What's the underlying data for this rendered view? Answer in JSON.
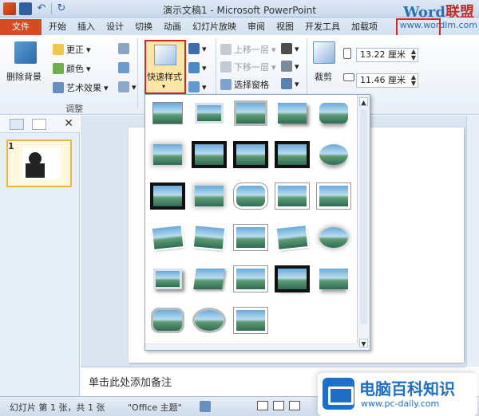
{
  "window": {
    "title": "演示文稿1 - Microsoft PowerPoint",
    "brand_word": "Word",
    "brand_cn": "联盟",
    "brand_url": "www.wordlm.com"
  },
  "qat": {
    "icons": [
      "powerpoint-app-icon",
      "save-icon",
      "undo-icon",
      "redo-icon"
    ]
  },
  "tabs": [
    {
      "label": "文件"
    },
    {
      "label": "开始"
    },
    {
      "label": "插入"
    },
    {
      "label": "设计"
    },
    {
      "label": "切换"
    },
    {
      "label": "动画"
    },
    {
      "label": "幻灯片放映"
    },
    {
      "label": "审阅"
    },
    {
      "label": "视图"
    },
    {
      "label": "开发工具"
    },
    {
      "label": "加载项"
    }
  ],
  "ribbon": {
    "adjust": {
      "remove_bg": "删除背景",
      "corrections": "更正",
      "color": "颜色",
      "artistic": "艺术效果",
      "group_label": "调整"
    },
    "styles": {
      "quick_styles": "快速样式"
    },
    "arrange": {
      "bring_forward": "上移一层",
      "send_backward": "下移一层",
      "selection_pane": "选择窗格"
    },
    "size": {
      "crop": "裁剪",
      "height": "13.22 厘米",
      "width": "11.46 厘米"
    }
  },
  "slides_pane": {
    "slide_number": "1"
  },
  "notes": {
    "placeholder": "单击此处添加备注"
  },
  "status": {
    "slide_info": "幻灯片 第 1 张，共 1 张",
    "theme": "\"Office 主题\""
  },
  "watermark_logo": {
    "title": "电脑百科知识",
    "url": "www.pc-daily.com"
  },
  "gallery": {
    "styles": [
      {
        "name": "simple-frame-white"
      },
      {
        "name": "beveled-matte-white"
      },
      {
        "name": "metal-frame"
      },
      {
        "name": "drop-shadow-rectangle"
      },
      {
        "name": "reflected-rounded-rectangle"
      },
      {
        "name": "soft-edge-rectangle"
      },
      {
        "name": "double-frame-black"
      },
      {
        "name": "thick-matte-black"
      },
      {
        "name": "simple-frame-black"
      },
      {
        "name": "beveled-oval-black"
      },
      {
        "name": "compound-frame-black"
      },
      {
        "name": "center-shadow-rectangle"
      },
      {
        "name": "rounded-diagonal-corner-white"
      },
      {
        "name": "snip-diagonal-corner-white"
      },
      {
        "name": "moderate-frame-white"
      },
      {
        "name": "rotated-white"
      },
      {
        "name": "perspective-shadow-white"
      },
      {
        "name": "relaxed-perspective-white"
      },
      {
        "name": "soft-edge-oval"
      },
      {
        "name": "bevel-rectangle"
      },
      {
        "name": "bevel-perspective"
      },
      {
        "name": "reflected-perspective-right"
      },
      {
        "name": "bevel-perspective-left-white"
      },
      {
        "name": "reflected-bevel-black"
      },
      {
        "name": "reflected-bevel-white"
      },
      {
        "name": "metal-rounded-rectangle"
      },
      {
        "name": "metal-oval"
      },
      {
        "name": "simple-frame-gray"
      }
    ]
  }
}
